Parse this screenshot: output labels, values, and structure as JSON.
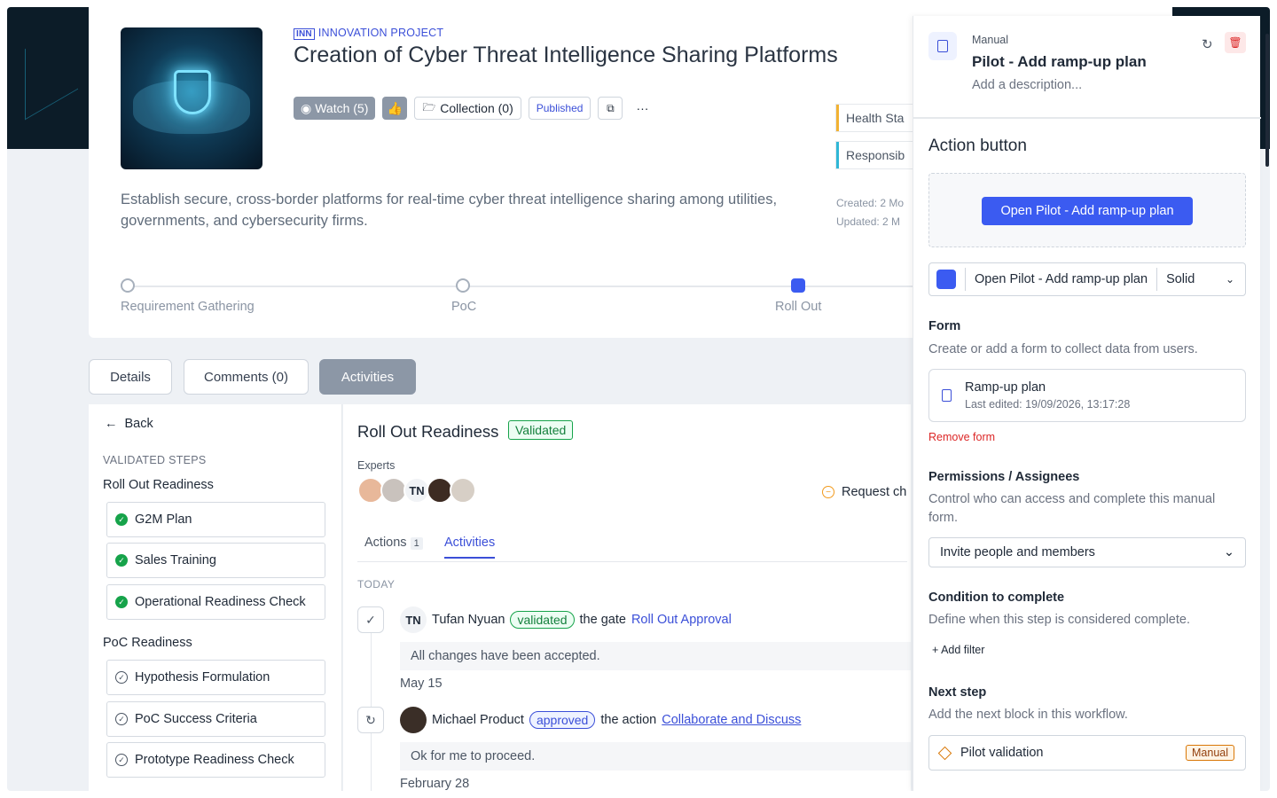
{
  "project": {
    "tag_abbr": "INN",
    "tag_label": "INNOVATION PROJECT",
    "title": "Creation of Cyber Threat Intelligence Sharing Platforms",
    "description": "Establish secure, cross-border platforms for real-time cyber threat intelligence sharing among utilities, governments, and cybersecurity firms.",
    "watch_label": "Watch (5)",
    "collection_label": "Collection (0)",
    "published_label": "Published",
    "more_label": "···",
    "health_tag": "Health Sta",
    "responsible_tag": "Responsib",
    "created": "Created: 2 Mo",
    "updated": "Updated: 2 M"
  },
  "stages": [
    {
      "label": "Requirement Gathering",
      "active": false
    },
    {
      "label": "PoC",
      "active": false
    },
    {
      "label": "Roll Out",
      "active": true
    }
  ],
  "tabs": {
    "details": "Details",
    "comments": "Comments (0)",
    "activities": "Activities"
  },
  "left": {
    "back": "Back",
    "validated_caption": "VALIDATED STEPS",
    "group1": "Roll Out Readiness",
    "group1_items": [
      "G2M Plan",
      "Sales Training",
      "Operational Readiness Check"
    ],
    "group2": "PoC Readiness",
    "group2_items": [
      "Hypothesis Formulation",
      "PoC Success Criteria",
      "Prototype Readiness Check"
    ]
  },
  "main": {
    "title": "Roll Out Readiness",
    "status": "Validated",
    "experts_label": "Experts",
    "expert_initials": "TN",
    "request_label": "Request ch",
    "tab_actions": "Actions",
    "tab_actions_count": "1",
    "tab_activities": "Activities",
    "today": "TODAY",
    "activity1": {
      "initials": "TN",
      "user": "Tufan Nyuan",
      "verb": "validated",
      "text": "the gate",
      "target": "Roll Out Approval",
      "comment": "All changes have been accepted.",
      "date": "May 15"
    },
    "activity2": {
      "user": "Michael Product",
      "verb": "approved",
      "text": "the action",
      "target": "Collaborate and Discuss",
      "comment": "Ok for me to proceed.",
      "date": "February 28"
    }
  },
  "drawer": {
    "type": "Manual",
    "title": "Pilot - Add ramp-up plan",
    "description_placeholder": "Add a description...",
    "action_button_title": "Action button",
    "preview_button": "Open Pilot - Add ramp-up plan",
    "button_label": "Open Pilot - Add ramp-up plan",
    "button_style": "Solid",
    "button_color": "#3b5bf1",
    "form_title": "Form",
    "form_desc": "Create or add a form to collect data from users.",
    "form_name": "Ramp-up plan",
    "form_edited": "Last edited: 19/09/2026, 13:17:28",
    "remove_form": "Remove form",
    "perm_title": "Permissions / Assignees",
    "perm_desc": "Control who can access and complete this manual form.",
    "invite": "Invite people and members",
    "cond_title": "Condition to complete",
    "cond_desc": "Define when this step is considered complete.",
    "add_filter": "+ Add filter",
    "next_title": "Next step",
    "next_desc": "Add the next block in this workflow.",
    "next_name": "Pilot validation",
    "next_badge": "Manual"
  },
  "icons": [
    "eye-icon",
    "thumbs-up-icon",
    "folder-icon",
    "share-icon",
    "more-icon",
    "arrow-left-icon",
    "check-circle-icon",
    "refresh-icon",
    "trash-icon",
    "document-icon",
    "chevron-down-icon",
    "diamond-icon",
    "clock-icon"
  ]
}
